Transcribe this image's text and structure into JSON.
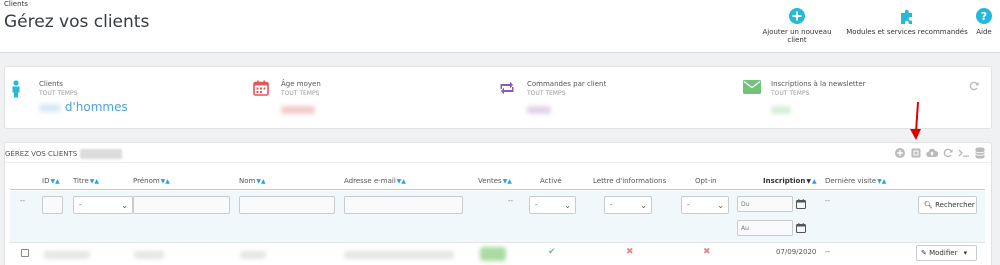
{
  "header": {
    "breadcrumb": "Clients",
    "title": "Gérez vos clients",
    "toolbar": {
      "add_label": "Ajouter un nouveau client",
      "modules_label": "Modules et services recommandés",
      "help_label": "Aide"
    }
  },
  "kpis": {
    "clients": {
      "title": "Clients",
      "sub": "TOUT TEMPS",
      "value": "d'hommes"
    },
    "age": {
      "title": "Âge moyen",
      "sub": "TOUT TEMPS"
    },
    "orders": {
      "title": "Commandes par client",
      "sub": "TOUT TEMPS"
    },
    "newsletter": {
      "title": "Inscriptions à la newsletter",
      "sub": "TOUT TEMPS"
    }
  },
  "panel": {
    "title": "GÉREZ VOS CLIENTS"
  },
  "table": {
    "headers": {
      "id": "ID",
      "titre": "Titre",
      "prenom": "Prénom",
      "nom": "Nom",
      "email": "Adresse e-mail",
      "ventes": "Ventes",
      "active": "Activé",
      "lettre": "Lettre d'informations",
      "optin": "Opt-in",
      "inscription": "Inscription",
      "derniere": "Dernière visite"
    },
    "filters": {
      "dash": "--",
      "select_value": "-",
      "du": "Du",
      "au": "Au",
      "search_label": "Rechercher"
    },
    "row": {
      "inscription_date": "07/09/2020",
      "derniere": "--",
      "modify_label": "Modifier"
    }
  },
  "colors": {
    "accent": "#25b9d7",
    "kpi_clients": "#25b9d7",
    "kpi_age": "#e25757",
    "kpi_orders": "#8e5cab",
    "kpi_newsletter": "#72c279",
    "arrow": "#e00000"
  },
  "icons": [
    "plus-circle-icon",
    "puzzle-icon",
    "question-circle-icon",
    "user-icon",
    "calendar-icon",
    "retweet-icon",
    "envelope-icon",
    "refresh-icon",
    "calendar-icon",
    "search-icon",
    "pencil-icon",
    "caret-down-icon"
  ]
}
